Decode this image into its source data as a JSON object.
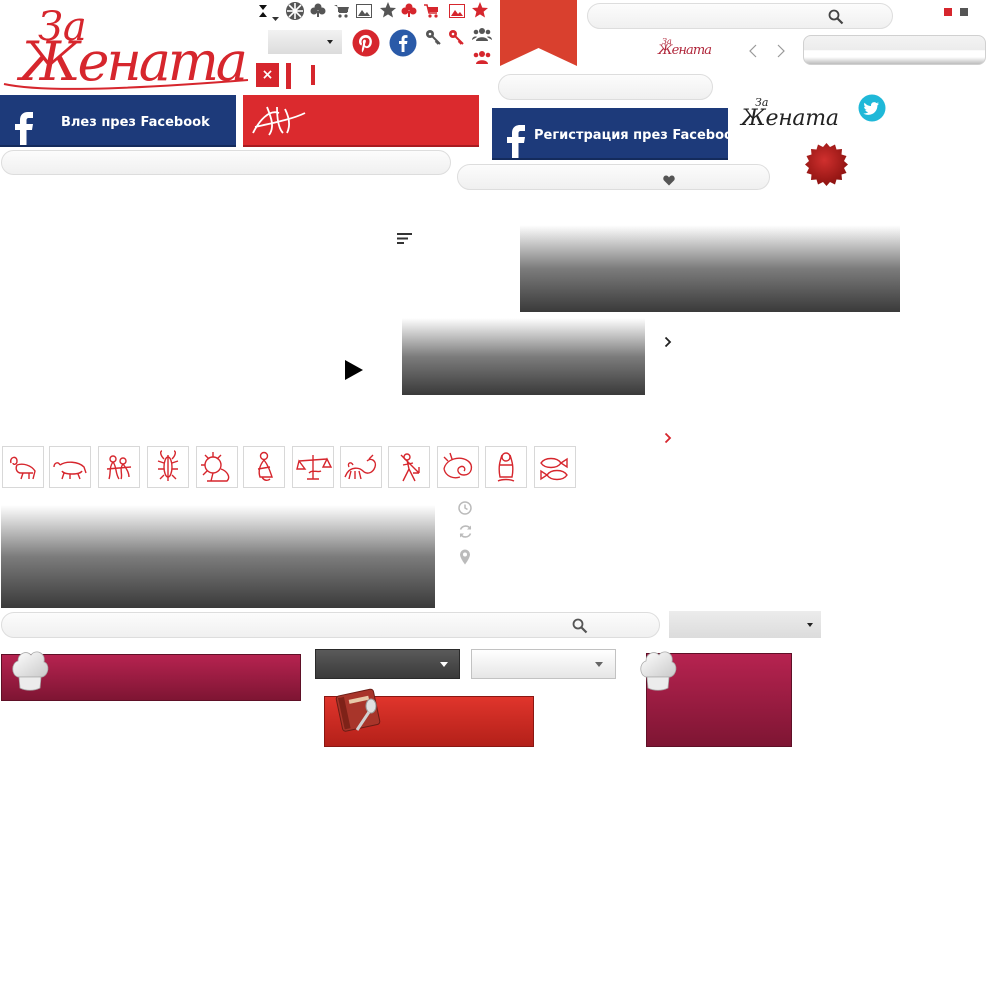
{
  "header": {
    "logo_text_za": "За",
    "logo_text_main": "Жената",
    "close_symbol": "×"
  },
  "facebook": {
    "login_label": "Влез през Facebook",
    "register_label": "Регистрация през Facebook"
  },
  "colors": {
    "brand_red": "#d6262d",
    "facebook_blue": "#1d3a7a",
    "twitter_cyan": "#1fb8d8",
    "berry": "#a51e48"
  },
  "zodiac": [
    {
      "name": "aries"
    },
    {
      "name": "taurus"
    },
    {
      "name": "gemini"
    },
    {
      "name": "cancer"
    },
    {
      "name": "leo"
    },
    {
      "name": "virgo"
    },
    {
      "name": "libra"
    },
    {
      "name": "scorpio"
    },
    {
      "name": "sagittarius"
    },
    {
      "name": "capricorn"
    },
    {
      "name": "aquarius"
    },
    {
      "name": "pisces"
    }
  ],
  "icons": {
    "toolbar_top": [
      "sort-arrows-icon",
      "chevron-down-icon",
      "aperture-icon",
      "club-icon",
      "cart-icon",
      "image-icon",
      "star-icon",
      "club-icon",
      "cart-icon",
      "image-icon",
      "star-icon"
    ],
    "meta": [
      "clock-icon",
      "refresh-icon",
      "map-pin-icon"
    ]
  }
}
